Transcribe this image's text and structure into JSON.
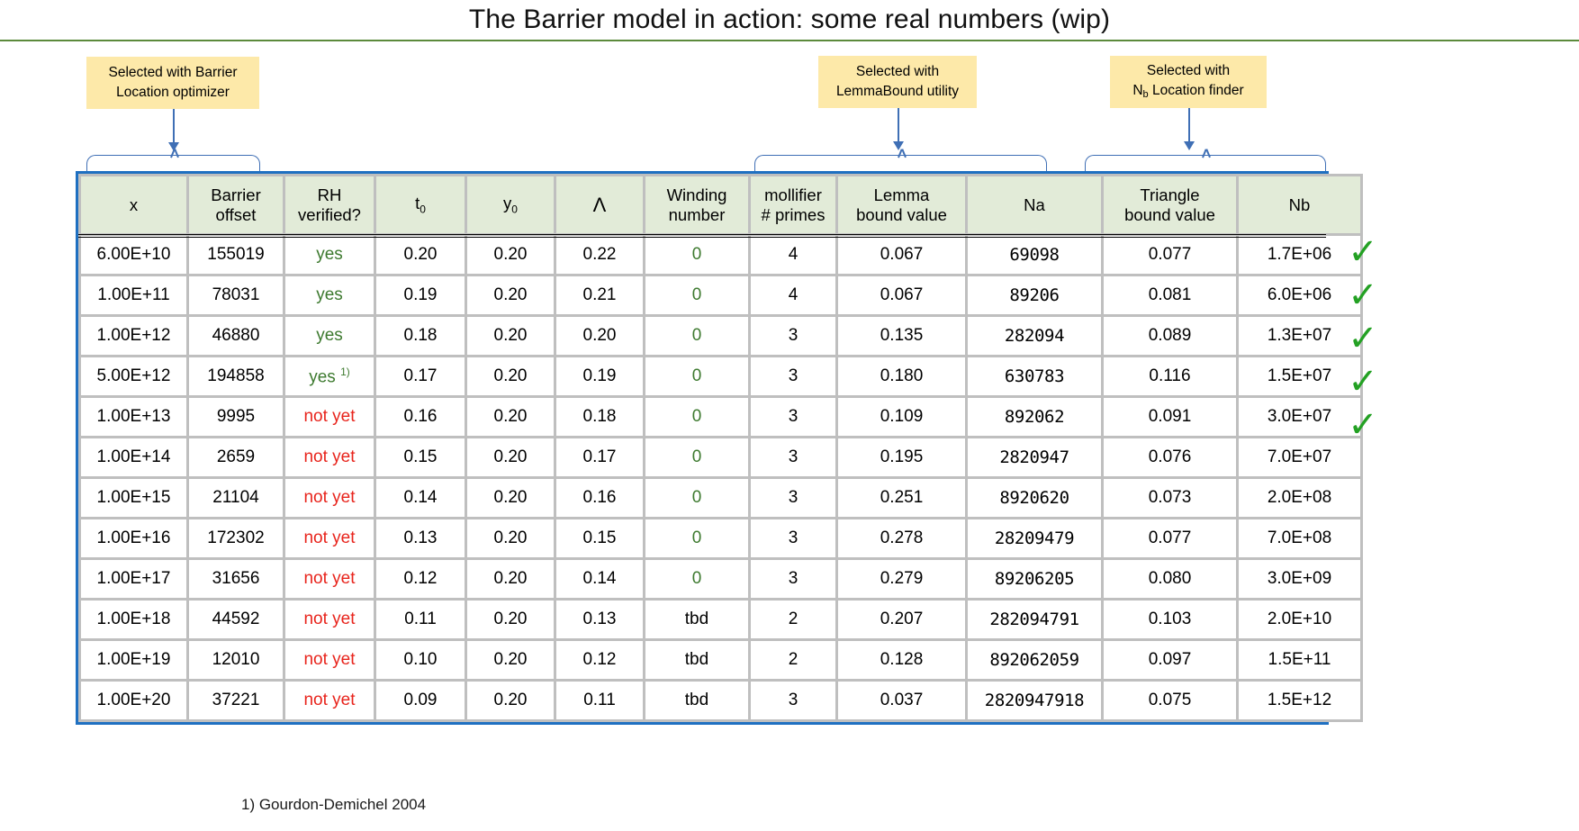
{
  "slide": {
    "title": "The Barrier model in action: some real numbers (wip)",
    "footnote": "1) Gourdon-Demichel 2004",
    "accent_rule_color": "#5c8a3c",
    "table_border_color": "#1f70c1",
    "callout_fill": "#fde9a9",
    "connector_color": "#3f6fb5",
    "check_color": "#24a124",
    "yes_color": "#3d7a2f",
    "notyet_color": "#e8241c"
  },
  "callouts": [
    {
      "line1": "Selected with Barrier",
      "line2": "Location optimizer"
    },
    {
      "line1": "Selected with",
      "line2": "LemmaBound utility"
    },
    {
      "line1": "Selected with",
      "line2_pre": "N",
      "line2_sub": "b",
      "line2_post": " Location finder"
    }
  ],
  "table": {
    "headers": [
      {
        "line1": "x",
        "line2": ""
      },
      {
        "line1": "Barrier",
        "line2": "offset"
      },
      {
        "line1": "RH",
        "line2": "verified?"
      },
      {
        "line1": "t",
        "sub": "0",
        "line2": ""
      },
      {
        "line1": "y",
        "sub": "0",
        "line2": ""
      },
      {
        "line1": "Λ",
        "line2": ""
      },
      {
        "line1": "Winding",
        "line2": "number"
      },
      {
        "line1": "mollifier",
        "line2": "# primes"
      },
      {
        "line1": "Lemma",
        "line2": "bound value"
      },
      {
        "line1": "Na",
        "line2": ""
      },
      {
        "line1": "Triangle",
        "line2": "bound value"
      },
      {
        "line1": "Nb",
        "line2": ""
      }
    ],
    "rows": [
      {
        "x": "6.00E+10",
        "barrier_offset": "155019",
        "rh_verified": "yes",
        "rh_note": "",
        "t0": "0.20",
        "y0": "0.20",
        "lambda": "0.22",
        "winding": "0",
        "mollifier": "4",
        "lemma_bound": "0.067",
        "na": "69098",
        "triangle_bound": "0.077",
        "nb": "1.7E+06",
        "check": true
      },
      {
        "x": "1.00E+11",
        "barrier_offset": "78031",
        "rh_verified": "yes",
        "rh_note": "",
        "t0": "0.19",
        "y0": "0.20",
        "lambda": "0.21",
        "winding": "0",
        "mollifier": "4",
        "lemma_bound": "0.067",
        "na": "89206",
        "triangle_bound": "0.081",
        "nb": "6.0E+06",
        "check": true
      },
      {
        "x": "1.00E+12",
        "barrier_offset": "46880",
        "rh_verified": "yes",
        "rh_note": "",
        "t0": "0.18",
        "y0": "0.20",
        "lambda": "0.20",
        "winding": "0",
        "mollifier": "3",
        "lemma_bound": "0.135",
        "na": "282094",
        "triangle_bound": "0.089",
        "nb": "1.3E+07",
        "check": true
      },
      {
        "x": "5.00E+12",
        "barrier_offset": "194858",
        "rh_verified": "yes",
        "rh_note": "1)",
        "t0": "0.17",
        "y0": "0.20",
        "lambda": "0.19",
        "winding": "0",
        "mollifier": "3",
        "lemma_bound": "0.180",
        "na": "630783",
        "triangle_bound": "0.116",
        "nb": "1.5E+07",
        "check": true
      },
      {
        "x": "1.00E+13",
        "barrier_offset": "9995",
        "rh_verified": "not yet",
        "rh_note": "",
        "t0": "0.16",
        "y0": "0.20",
        "lambda": "0.18",
        "winding": "0",
        "mollifier": "3",
        "lemma_bound": "0.109",
        "na": "892062",
        "triangle_bound": "0.091",
        "nb": "3.0E+07",
        "check": true
      },
      {
        "x": "1.00E+14",
        "barrier_offset": "2659",
        "rh_verified": "not yet",
        "rh_note": "",
        "t0": "0.15",
        "y0": "0.20",
        "lambda": "0.17",
        "winding": "0",
        "mollifier": "3",
        "lemma_bound": "0.195",
        "na": "2820947",
        "triangle_bound": "0.076",
        "nb": "7.0E+07",
        "check": false
      },
      {
        "x": "1.00E+15",
        "barrier_offset": "21104",
        "rh_verified": "not yet",
        "rh_note": "",
        "t0": "0.14",
        "y0": "0.20",
        "lambda": "0.16",
        "winding": "0",
        "mollifier": "3",
        "lemma_bound": "0.251",
        "na": "8920620",
        "triangle_bound": "0.073",
        "nb": "2.0E+08",
        "check": false
      },
      {
        "x": "1.00E+16",
        "barrier_offset": "172302",
        "rh_verified": "not yet",
        "rh_note": "",
        "t0": "0.13",
        "y0": "0.20",
        "lambda": "0.15",
        "winding": "0",
        "mollifier": "3",
        "lemma_bound": "0.278",
        "na": "28209479",
        "triangle_bound": "0.077",
        "nb": "7.0E+08",
        "check": false
      },
      {
        "x": "1.00E+17",
        "barrier_offset": "31656",
        "rh_verified": "not yet",
        "rh_note": "",
        "t0": "0.12",
        "y0": "0.20",
        "lambda": "0.14",
        "winding": "0",
        "mollifier": "3",
        "lemma_bound": "0.279",
        "na": "89206205",
        "triangle_bound": "0.080",
        "nb": "3.0E+09",
        "check": false
      },
      {
        "x": "1.00E+18",
        "barrier_offset": "44592",
        "rh_verified": "not yet",
        "rh_note": "",
        "t0": "0.11",
        "y0": "0.20",
        "lambda": "0.13",
        "winding": "tbd",
        "mollifier": "2",
        "lemma_bound": "0.207",
        "na": "282094791",
        "triangle_bound": "0.103",
        "nb": "2.0E+10",
        "check": false
      },
      {
        "x": "1.00E+19",
        "barrier_offset": "12010",
        "rh_verified": "not yet",
        "rh_note": "",
        "t0": "0.10",
        "y0": "0.20",
        "lambda": "0.12",
        "winding": "tbd",
        "mollifier": "2",
        "lemma_bound": "0.128",
        "na": "892062059",
        "triangle_bound": "0.097",
        "nb": "1.5E+11",
        "check": false
      },
      {
        "x": "1.00E+20",
        "barrier_offset": "37221",
        "rh_verified": "not yet",
        "rh_note": "",
        "t0": "0.09",
        "y0": "0.20",
        "lambda": "0.11",
        "winding": "tbd",
        "mollifier": "3",
        "lemma_bound": "0.037",
        "na": "2820947918",
        "triangle_bound": "0.075",
        "nb": "1.5E+12",
        "check": false
      }
    ]
  },
  "icons": {
    "check_glyph": "✓"
  }
}
